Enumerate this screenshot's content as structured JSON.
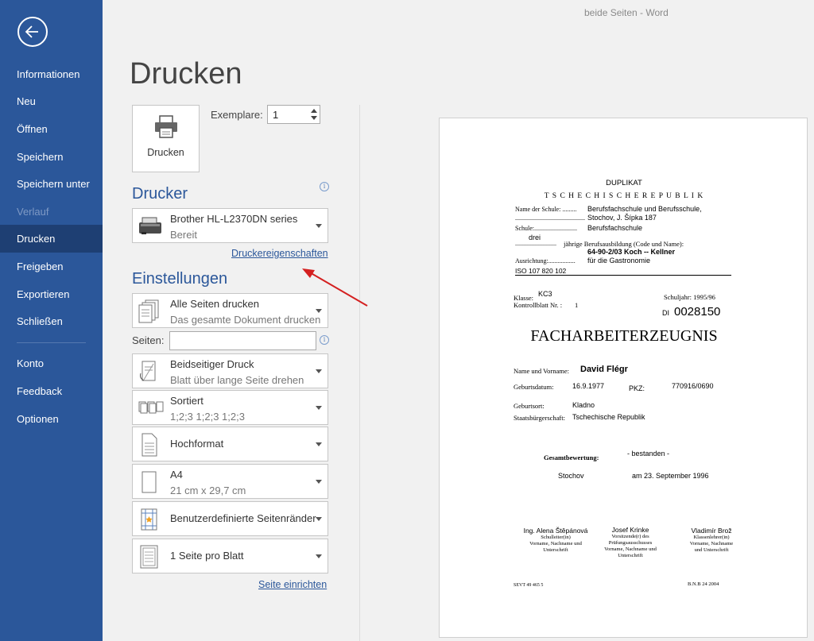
{
  "window": {
    "title": "beide Seiten  -  Word"
  },
  "sidebar": {
    "items": [
      {
        "label": "Informationen"
      },
      {
        "label": "Neu"
      },
      {
        "label": "Öffnen"
      },
      {
        "label": "Speichern"
      },
      {
        "label": "Speichern unter"
      },
      {
        "label": "Verlauf"
      },
      {
        "label": "Drucken"
      },
      {
        "label": "Freigeben"
      },
      {
        "label": "Exportieren"
      },
      {
        "label": "Schließen"
      },
      {
        "label": "Konto"
      },
      {
        "label": "Feedback"
      },
      {
        "label": "Optionen"
      }
    ],
    "active": "Drucken",
    "disabled": "Verlauf"
  },
  "print": {
    "title": "Drucken",
    "button_label": "Drucken",
    "copies_label": "Exemplare:",
    "copies_value": "1"
  },
  "printer": {
    "section_title": "Drucker",
    "name": "Brother HL-L2370DN series",
    "status": "Bereit",
    "properties_link": "Druckereigenschaften"
  },
  "settings": {
    "section_title": "Einstellungen",
    "range": {
      "line1": "Alle Seiten drucken",
      "line2": "Das gesamte Dokument drucken"
    },
    "pages_label": "Seiten:",
    "pages_value": "",
    "duplex": {
      "line1": "Beidseitiger Druck",
      "line2": "Blatt über lange Seite drehen"
    },
    "collate": {
      "line1": "Sortiert",
      "line2": "1;2;3     1;2;3     1;2;3"
    },
    "orientation": {
      "line1": "Hochformat"
    },
    "paper": {
      "line1": "A4",
      "line2": "21 cm x 29,7 cm"
    },
    "margins": {
      "line1": "Benutzerdefinierte Seitenränder"
    },
    "per_sheet": {
      "line1": "1 Seite pro Blatt"
    },
    "page_setup_link": "Seite einrichten"
  },
  "document": {
    "duplikat": "DUPLIKAT",
    "republic": "T S C H E C H I S C H E   R E P U B L I K",
    "school_label": "Name der Schule: .........",
    "school_value1": "Berufsfachschule und Berufsschule,",
    "school_dots": "............................................",
    "school_value2": "Stochov, J. Šípka 187",
    "schule_label": "Schule:...........................",
    "schule_value": "Berufsfachschule",
    "drei": "drei",
    "ausbildung_dots": "..........................",
    "ausbildung_label": "jährige Berufsausbildung (Code und Name):",
    "ausbildung_code": "64-90-2/03 Koch -- Kellner",
    "ausrichtung_label": "Ausrichtung:.................",
    "ausrichtung_value": "für die Gastronomie",
    "iso": "ISO   107 820 102",
    "klasse_label": "Klasse:",
    "klasse_value": "KC3",
    "schuljahr": "Schuljahr: 1995/96",
    "kontrollblatt_label": "Kontrollblatt Nr. :",
    "kontrollblatt_value": "1",
    "di_label": "DI",
    "di_number": "0028150",
    "heading": "FACHARBEITERZEUGNIS",
    "name_label": "Name und Vorname:",
    "name_value": "David Flégr",
    "geburtsdatum_label": "Geburtsdatum:",
    "geburtsdatum_value": "16.9.1977",
    "pkz_label": "PKZ:",
    "pkz_value": "770916/0690",
    "geburtsort_label": "Geburtsort:",
    "geburtsort_value": "Kladno",
    "staat_label": "Staatsbürgerschaft:",
    "staat_value": "Tschechische Republik",
    "gesamt_label": "Gesamtbewertung:",
    "gesamt_value": "- bestanden -",
    "ort": "Stochov",
    "datum": "am 23. September 1996",
    "sig1_name": "Ing. Alena Štěpánová",
    "sig1_role": "Schulleiter(in)",
    "sig1_sub": "Vorname, Nachname und",
    "sig1_sub2": "Unterschrift",
    "sig2_name": "Josef Krinke",
    "sig2_role": "Vorsitzende(r) des",
    "sig2_role2": "Prüfungsausschusses",
    "sig2_sub": "Vorname, Nachname und",
    "sig2_sub2": "Unterschrift",
    "sig3_name": "Vladimír Brož",
    "sig3_role": "Klassenlehrer(in)",
    "sig3_sub": "Vorname, Nachname",
    "sig3_sub2": "und Unterschrift",
    "footer_left": "SEVT 49 465 5",
    "footer_right": "B.N.B 24 2004"
  }
}
